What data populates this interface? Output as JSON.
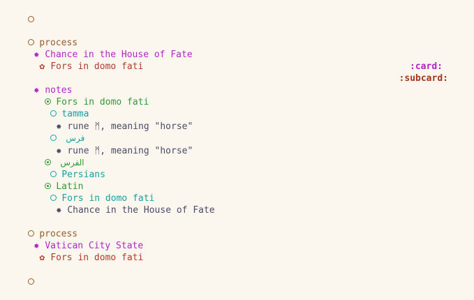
{
  "colors": {
    "heading1": "#9a5a2a",
    "heading2": "#b223c8",
    "heading3": "#b23a2a",
    "green": "#2f9a35",
    "teal": "#16a0a0",
    "body": "#4a4a68",
    "tag": "#b223c8",
    "subtag": "#a2361f"
  },
  "lines": [
    {
      "bullet_icon": "hollow-circle-icon",
      "text": ""
    },
    {
      "bullet_icon": "hollow-circle-icon",
      "text": "process"
    },
    {
      "bullet_icon": "asterisk-bullet-icon",
      "text": "Chance in the House of Fate",
      "tag": ":card:"
    },
    {
      "bullet_icon": "flower-bullet-icon",
      "text": "Fors in domo fati",
      "tag": ":subcard:"
    },
    {
      "bullet_icon": "asterisk-bullet-icon",
      "text": "notes"
    },
    {
      "bullet_icon": "dotted-circle-icon",
      "text": "Fors in domo fati"
    },
    {
      "bullet_icon": "hollow-circle-icon",
      "text": "tamma"
    },
    {
      "bullet_icon": "asterisk-bullet-icon",
      "text": "rune ᛗ, meaning \"horse\""
    },
    {
      "bullet_icon": "hollow-circle-icon",
      "text": "فرس"
    },
    {
      "bullet_icon": "asterisk-bullet-icon",
      "text": "rune ᛗ, meaning \"horse\""
    },
    {
      "bullet_icon": "dotted-circle-icon",
      "text": "الفرس"
    },
    {
      "bullet_icon": "hollow-circle-icon",
      "text": "Persians"
    },
    {
      "bullet_icon": "dotted-circle-icon",
      "text": "Latin"
    },
    {
      "bullet_icon": "hollow-circle-icon",
      "text": "Fors in domo fati"
    },
    {
      "bullet_icon": "asterisk-bullet-icon",
      "text": "Chance in the House of Fate"
    },
    {
      "bullet_icon": "hollow-circle-icon",
      "text": "process"
    },
    {
      "bullet_icon": "asterisk-bullet-icon",
      "text": "Vatican City State"
    },
    {
      "bullet_icon": "flower-bullet-icon",
      "text": "Fors in domo fati"
    },
    {
      "bullet_icon": "hollow-circle-icon",
      "text": ""
    }
  ]
}
